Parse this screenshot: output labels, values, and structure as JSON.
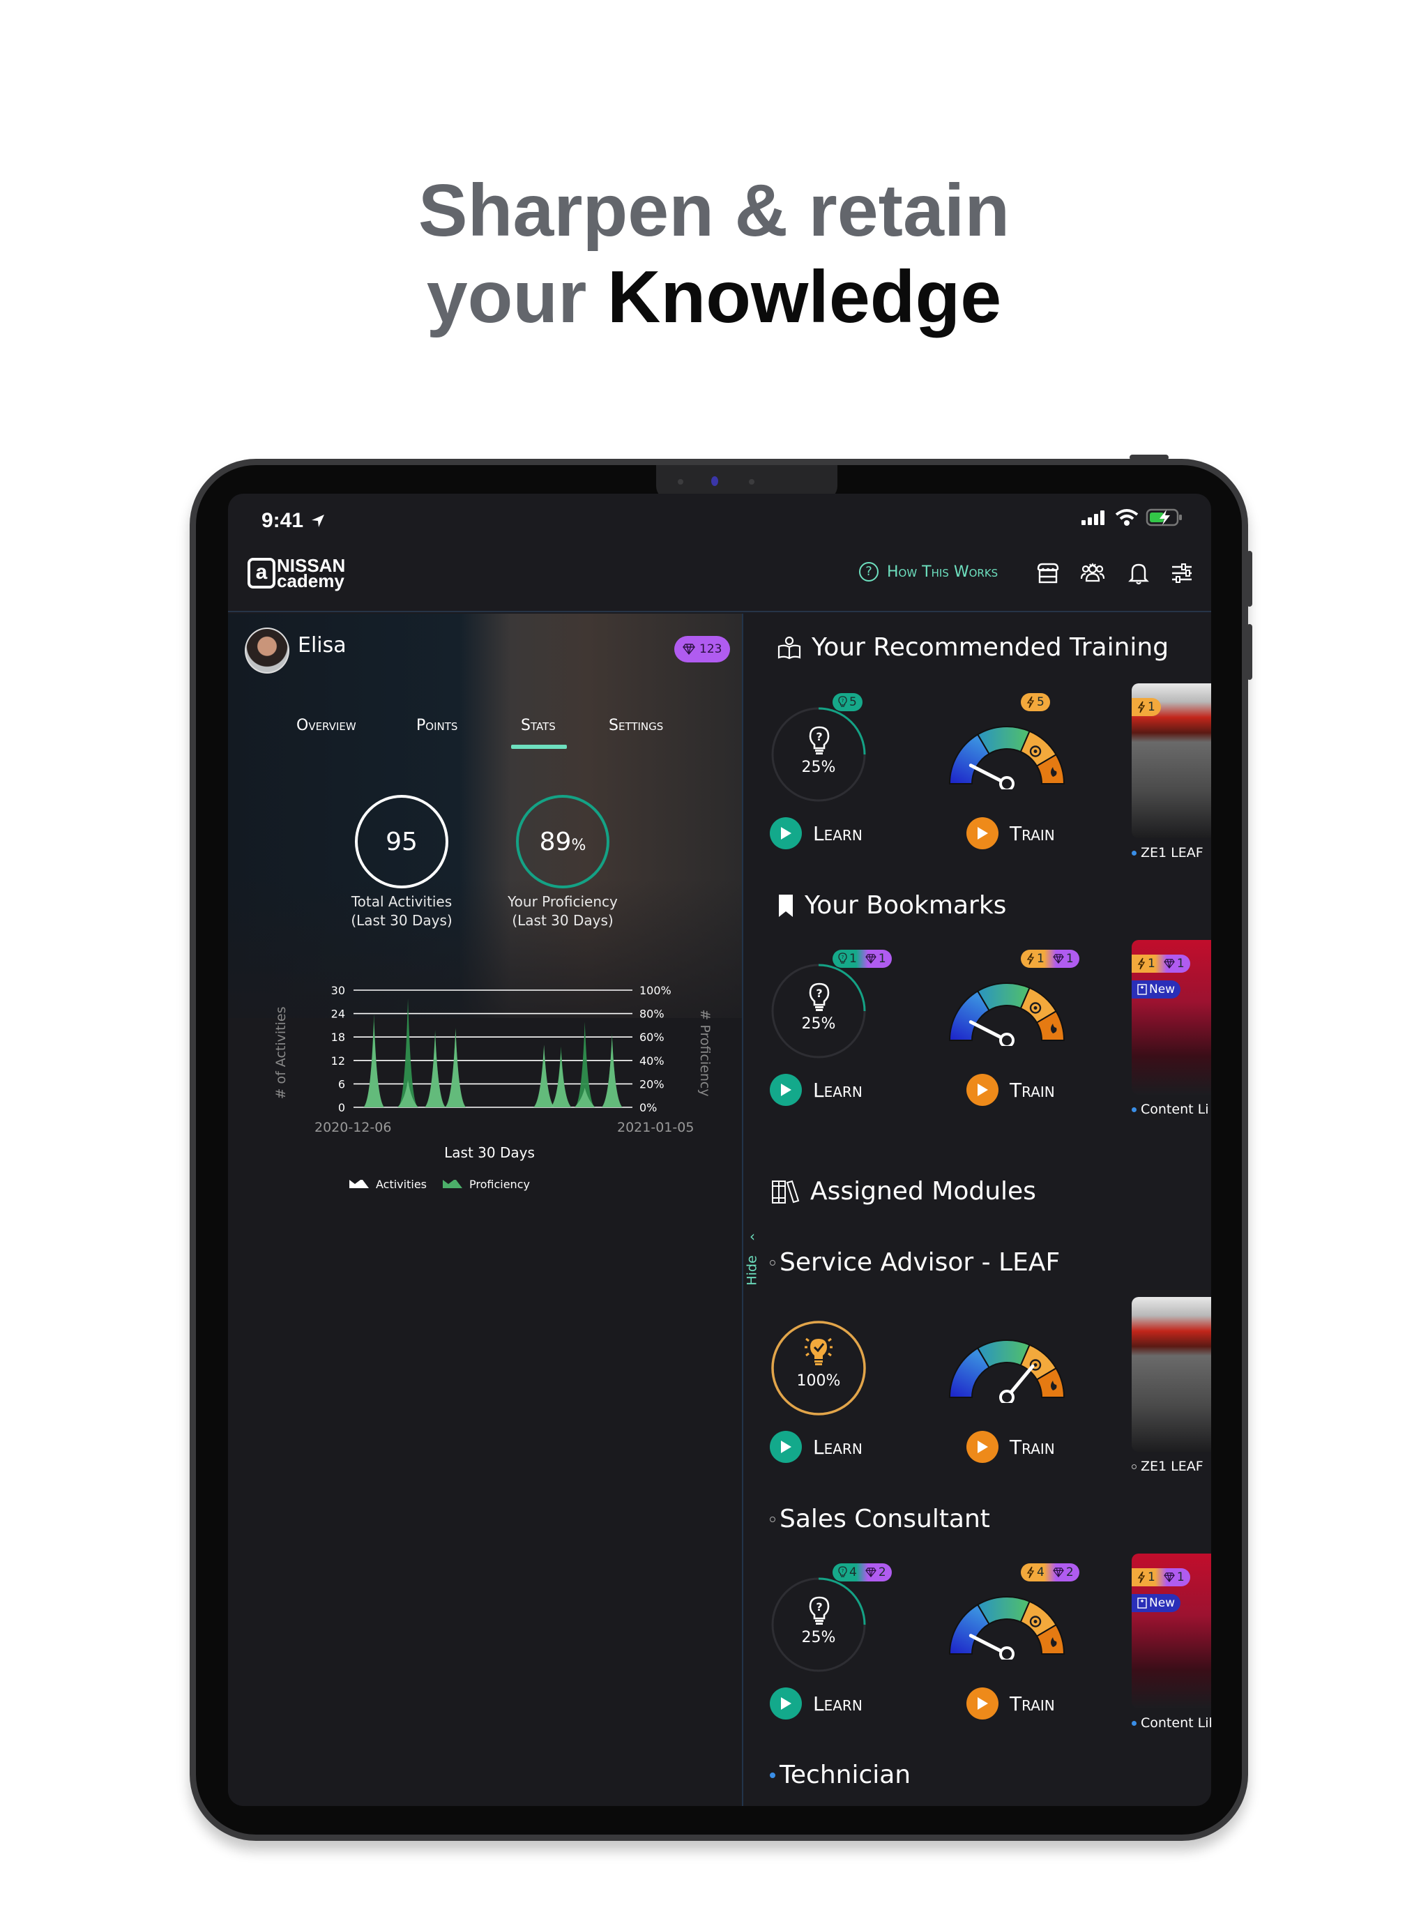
{
  "promo": {
    "line1": "Sharpen & retain",
    "line2_prefix": "your ",
    "line2_strong": "Knowledge"
  },
  "status_bar": {
    "time": "9:41",
    "icons": [
      "location-arrow-icon",
      "signal-icon",
      "wifi-icon",
      "battery-charging-icon"
    ]
  },
  "header": {
    "logo_at": "a",
    "logo_line1": "NISSAN",
    "logo_line2": "cademy",
    "how_this_works": "How This Works",
    "icons": [
      "store-icon",
      "team-icon",
      "bell-icon",
      "sliders-icon"
    ]
  },
  "profile": {
    "name": "Elisa",
    "gems": "123",
    "tabs": [
      {
        "label": "Overview",
        "active": false
      },
      {
        "label": "Points",
        "active": false
      },
      {
        "label": "Stats",
        "active": true
      },
      {
        "label": "Settings",
        "active": false
      }
    ],
    "stats": [
      {
        "value": "95",
        "suffix": "",
        "label1": "Total Activities",
        "label2": "(Last 30 Days)"
      },
      {
        "value": "89",
        "suffix": "%",
        "label1": "Your Proficiency",
        "label2": "(Last 30 Days)"
      }
    ]
  },
  "chart_data": {
    "type": "area",
    "title": "",
    "xlabel": "Last 30 Days",
    "ylabel": "# of Activities",
    "ylabel_right": "# Proficiency",
    "x_ticks": [
      "2020-12-06",
      "2021-01-05"
    ],
    "y_ticks": [
      0,
      6,
      12,
      18,
      24,
      30
    ],
    "y2_ticks": [
      "0%",
      "20%",
      "40%",
      "60%",
      "80%",
      "100%"
    ],
    "ylim": [
      0,
      30
    ],
    "y2lim": [
      0,
      100
    ],
    "grid": true,
    "legend": "bottom",
    "x_days": 30,
    "series": [
      {
        "name": "Activities",
        "points": [
          [
            3,
            22
          ],
          [
            8,
            7
          ],
          [
            12,
            19
          ],
          [
            15,
            20
          ],
          [
            28,
            16
          ],
          [
            30.5,
            14
          ],
          [
            34,
            5
          ],
          [
            38,
            18
          ]
        ]
      },
      {
        "name": "Proficiency",
        "points": [
          [
            3,
            80
          ],
          [
            8,
            93
          ],
          [
            12,
            66
          ],
          [
            15,
            68
          ],
          [
            28,
            53
          ],
          [
            30.5,
            52
          ],
          [
            34,
            73
          ],
          [
            38,
            63
          ]
        ]
      }
    ]
  },
  "hide_label": "Hide",
  "sections": {
    "recommended": {
      "title": "Your Recommended Training",
      "learn": {
        "pct": "25%",
        "progress": 0.25,
        "pill": {
          "bulb": "5"
        }
      },
      "train": {
        "needle": 0.15,
        "pill": {
          "bolt": "5"
        }
      },
      "card": {
        "pill": {
          "bolt": "1"
        },
        "label": "ZE1 LEAF"
      }
    },
    "bookmarks": {
      "title": "Your Bookmarks",
      "learn": {
        "pct": "25%",
        "progress": 0.25,
        "pill": {
          "bulb": "1",
          "gem": "1"
        }
      },
      "train": {
        "needle": 0.15,
        "pill": {
          "bolt": "1",
          "gem": "1"
        }
      },
      "card": {
        "pill": {
          "bolt": "1",
          "gem": "1"
        },
        "new_label": "New",
        "label": "Content Li"
      }
    },
    "assigned": {
      "title": "Assigned Modules",
      "modules": [
        {
          "name": "Service Advisor - LEAF",
          "learn": {
            "pct": "100%",
            "progress": 1.0
          },
          "train": {
            "needle": 0.72
          },
          "card": {
            "label": "ZE1 LEAF"
          }
        },
        {
          "name": "Sales Consultant",
          "learn": {
            "pct": "25%",
            "progress": 0.25,
            "pill": {
              "bulb": "4",
              "gem": "2"
            }
          },
          "train": {
            "needle": 0.15,
            "pill": {
              "bolt": "4",
              "gem": "2"
            }
          },
          "card": {
            "pill": {
              "bolt": "1",
              "gem": "1"
            },
            "new_label": "New",
            "label": "Content Lil"
          }
        },
        {
          "name": "Technician"
        }
      ]
    }
  },
  "buttons": {
    "learn": "Learn",
    "train": "Train"
  },
  "colors": {
    "accent_teal": "#6ee0bf",
    "learn_teal": "#13a98b",
    "train_orange": "#ee8a1a",
    "gem_purple": "#b05cf0",
    "proficiency_green": "#4caf6a"
  }
}
